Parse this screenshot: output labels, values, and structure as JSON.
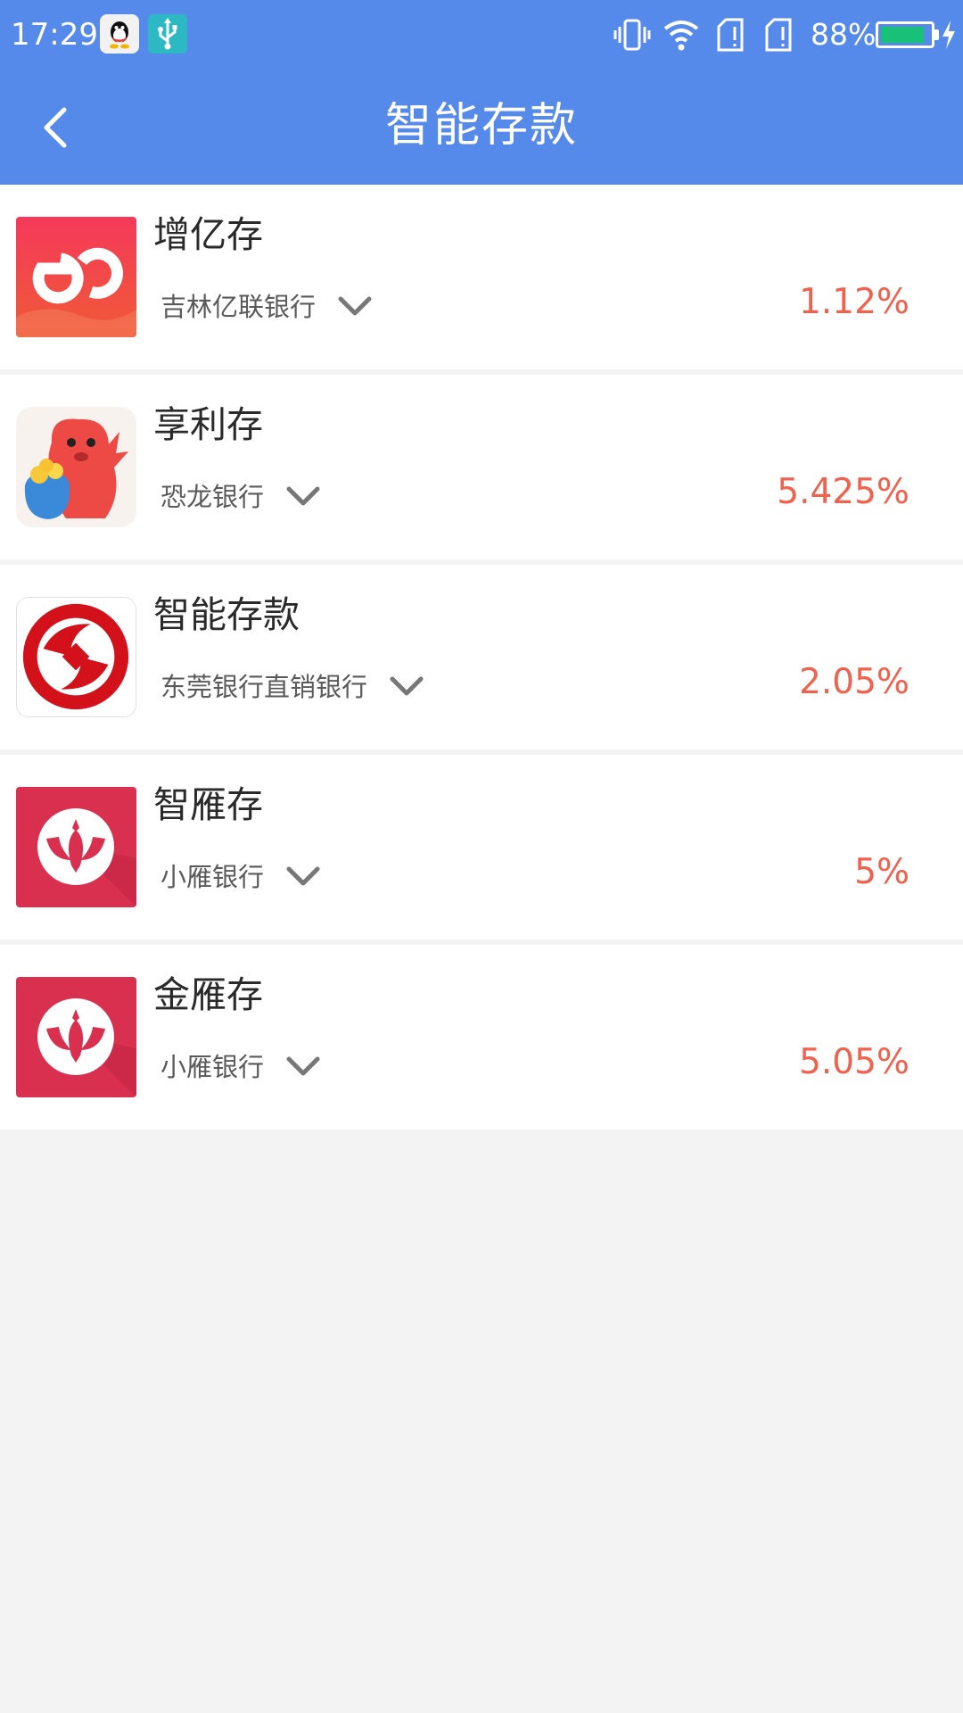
{
  "status_bar": {
    "time": "17:29",
    "battery_text": "88%",
    "battery_level": 0.88,
    "icons": [
      "qq-icon",
      "usb-icon",
      "vibrate-icon",
      "wifi-icon",
      "sim1-icon",
      "sim2-icon",
      "battery-icon",
      "charging-icon"
    ]
  },
  "header": {
    "title": "智能存款",
    "back_icon": "chevron-left-icon"
  },
  "colors": {
    "primary": "#558aeb",
    "rate": "#f0614e",
    "background": "#f3f3f3"
  },
  "products": [
    {
      "name": "增亿存",
      "bank": "吉林亿联银行",
      "rate": "1.12%",
      "logo": "yilian-bank-logo"
    },
    {
      "name": "享利存",
      "bank": "恐龙银行",
      "rate": "5.425%",
      "logo": "dinosaur-bank-logo"
    },
    {
      "name": "智能存款",
      "bank": "东莞银行直销银行",
      "rate": "2.05%",
      "logo": "dongguan-bank-logo"
    },
    {
      "name": "智雁存",
      "bank": "小雁银行",
      "rate": "5%",
      "logo": "xiaoyan-bank-logo"
    },
    {
      "name": "金雁存",
      "bank": "小雁银行",
      "rate": "5.05%",
      "logo": "xiaoyan-bank-logo"
    }
  ]
}
